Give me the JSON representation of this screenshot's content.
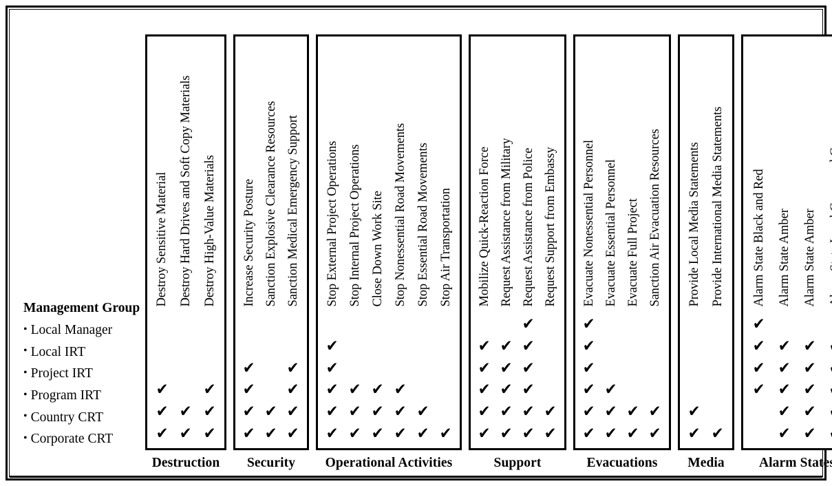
{
  "table": {
    "row_header_title": "Management Group",
    "bullet_glyph": "•",
    "check_glyph": "✔",
    "rows": [
      "Local Manager",
      "Local IRT",
      "Project IRT",
      "Program IRT",
      "Country CRT",
      "Corporate CRT"
    ],
    "groups": [
      {
        "caption": "Destruction",
        "columns": [
          "Destroy Sensitive Material",
          "Destroy Hard Drives and Soft Copy Materials",
          "Destroy High-Value Materials"
        ],
        "marks": [
          [
            false,
            false,
            false
          ],
          [
            false,
            false,
            false
          ],
          [
            false,
            false,
            false
          ],
          [
            true,
            false,
            true
          ],
          [
            true,
            true,
            true
          ],
          [
            true,
            true,
            true
          ]
        ]
      },
      {
        "caption": "Security",
        "columns": [
          "Increase Security Posture",
          "Sanction Explosive Clearance Resources",
          "Sanction Medical Emergency Support"
        ],
        "marks": [
          [
            false,
            false,
            false
          ],
          [
            false,
            false,
            false
          ],
          [
            true,
            false,
            true
          ],
          [
            true,
            false,
            true
          ],
          [
            true,
            true,
            true
          ],
          [
            true,
            true,
            true
          ]
        ]
      },
      {
        "caption": "Operational Activities",
        "columns": [
          "Stop External Project Operations",
          "Stop Internal Project Operations",
          "Close Down Work Site",
          "Stop Nonessential Road Movements",
          "Stop Essential Road Movements",
          "Stop Air Transportation"
        ],
        "marks": [
          [
            false,
            false,
            false,
            false,
            false,
            false
          ],
          [
            true,
            false,
            false,
            false,
            false,
            false
          ],
          [
            true,
            false,
            false,
            false,
            false,
            false
          ],
          [
            true,
            true,
            true,
            true,
            false,
            false
          ],
          [
            true,
            true,
            true,
            true,
            true,
            false
          ],
          [
            true,
            true,
            true,
            true,
            true,
            true
          ]
        ]
      },
      {
        "caption": "Support",
        "columns": [
          "Mobilize Quick-Reaction Force",
          "Request Assistance from Military",
          "Request Assistance from Police",
          "Request Support from Embassy"
        ],
        "marks": [
          [
            false,
            false,
            true,
            false
          ],
          [
            true,
            true,
            true,
            false
          ],
          [
            true,
            true,
            true,
            false
          ],
          [
            true,
            true,
            true,
            false
          ],
          [
            true,
            true,
            true,
            true
          ],
          [
            true,
            true,
            true,
            true
          ]
        ]
      },
      {
        "caption": "Evacuations",
        "columns": [
          "Evacuate Nonessential Personnel",
          "Evacuate Essential Personnel",
          "Evacuate Full Project",
          "Sanction Air Evacuation Resources"
        ],
        "marks": [
          [
            true,
            false,
            false,
            false
          ],
          [
            true,
            false,
            false,
            false
          ],
          [
            true,
            false,
            false,
            false
          ],
          [
            true,
            true,
            false,
            false
          ],
          [
            true,
            true,
            true,
            true
          ],
          [
            true,
            true,
            true,
            true
          ]
        ]
      },
      {
        "caption": "Media",
        "columns": [
          "Provide Local Media Statements",
          "Provide International Media Statements"
        ],
        "marks": [
          [
            false,
            false
          ],
          [
            false,
            false
          ],
          [
            false,
            false
          ],
          [
            false,
            false
          ],
          [
            true,
            false
          ],
          [
            true,
            true
          ]
        ]
      },
      {
        "caption": "Alarm States",
        "columns": [
          "Alarm State Black and Red",
          "Alarm State Amber",
          "Alarm State Amber",
          "Alarm State Local Green and Green"
        ],
        "marks": [
          [
            true,
            false,
            false,
            false
          ],
          [
            true,
            true,
            true,
            true
          ],
          [
            true,
            true,
            true,
            true
          ],
          [
            true,
            true,
            true,
            true
          ],
          [
            false,
            true,
            true,
            true
          ],
          [
            false,
            true,
            true,
            true
          ]
        ]
      }
    ]
  }
}
